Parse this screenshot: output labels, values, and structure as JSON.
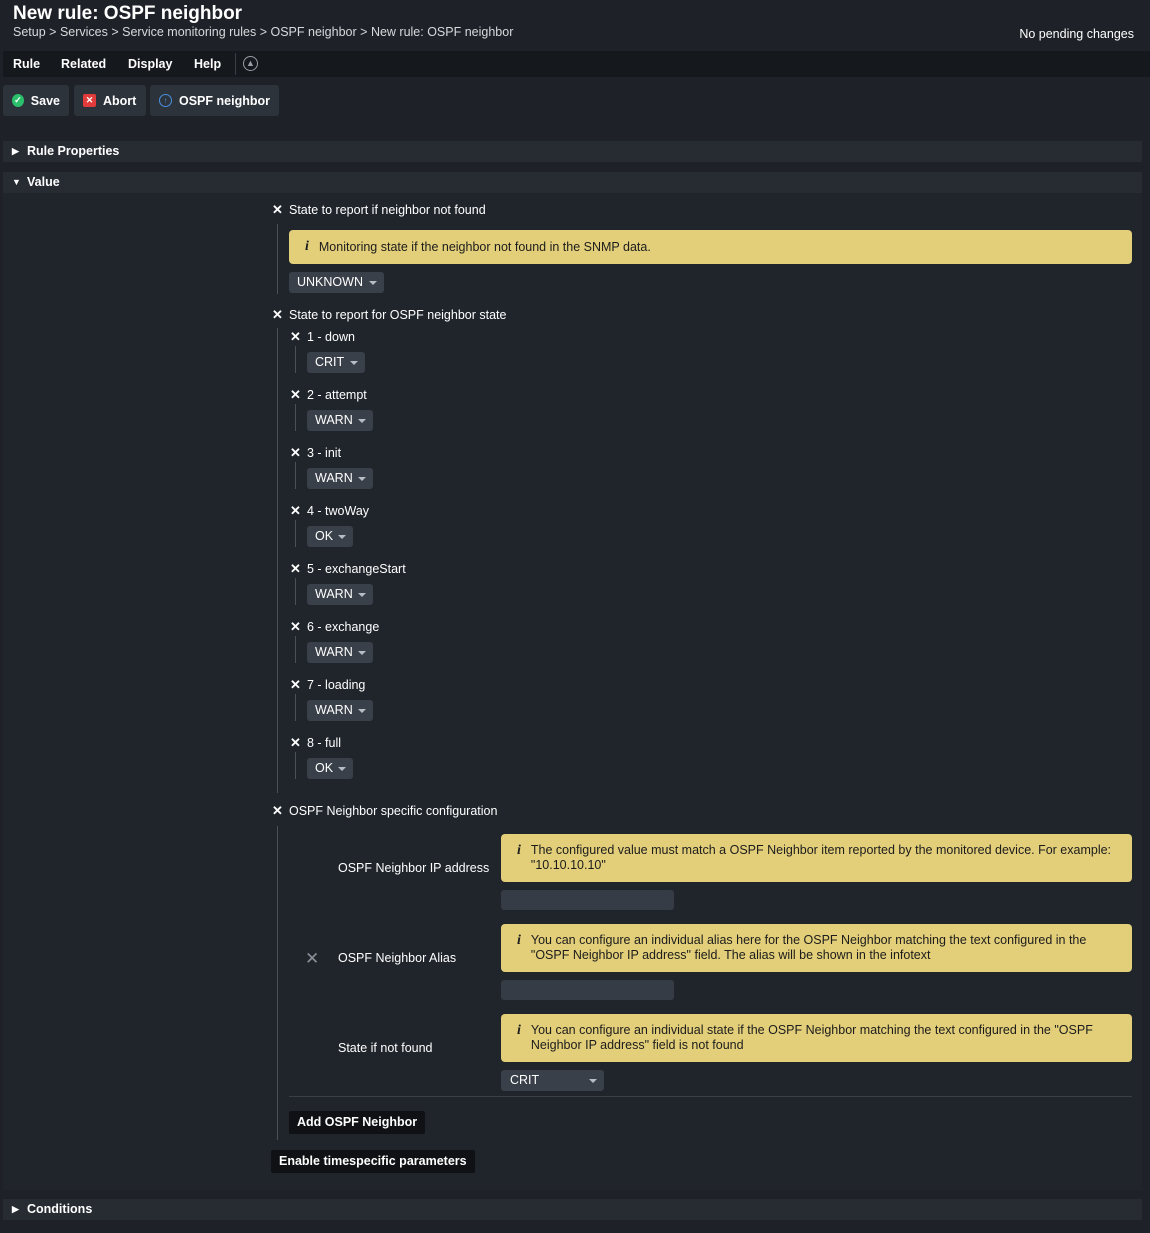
{
  "header": {
    "title": "New rule: OSPF neighbor",
    "breadcrumb": [
      "Setup",
      "Services",
      "Service monitoring rules",
      "OSPF neighbor",
      "New rule: OSPF neighbor"
    ],
    "pending": "No pending changes"
  },
  "menu": {
    "rule": "Rule",
    "related": "Related",
    "display": "Display",
    "help": "Help"
  },
  "toolbar": {
    "save": "Save",
    "abort": "Abort",
    "ospf": "OSPF neighbor"
  },
  "sections": {
    "rule_properties": "Rule Properties",
    "value": "Value",
    "conditions": "Conditions"
  },
  "not_found": {
    "label": "State to report if neighbor not found",
    "help": "Monitoring state if the neighbor not found in the SNMP data.",
    "value": "UNKNOWN"
  },
  "neighbor_state": {
    "label": "State to report for OSPF neighbor state",
    "items": [
      {
        "label": "1 - down",
        "value": "CRIT"
      },
      {
        "label": "2 - attempt",
        "value": "WARN"
      },
      {
        "label": "3 - init",
        "value": "WARN"
      },
      {
        "label": "4 - twoWay",
        "value": "OK"
      },
      {
        "label": "5 - exchangeStart",
        "value": "WARN"
      },
      {
        "label": "6 - exchange",
        "value": "WARN"
      },
      {
        "label": "7 - loading",
        "value": "WARN"
      },
      {
        "label": "8 - full",
        "value": "OK"
      }
    ]
  },
  "specific": {
    "label": "OSPF Neighbor specific configuration",
    "ip_label": "OSPF Neighbor IP address",
    "ip_help": "The configured value must match a OSPF Neighbor item reported by the monitored device. For example: \"10.10.10.10\"",
    "ip_value": "",
    "alias_label": "OSPF Neighbor Alias",
    "alias_help": "You can configure an individual alias here for the OSPF Neighbor matching the text configured in the \"OSPF Neighbor IP address\" field. The alias will be shown in the infotext",
    "alias_value": "",
    "state_label": "State if not found",
    "state_help": "You can configure an individual state if the OSPF Neighbor matching the text configured in the \"OSPF Neighbor IP address\" field is not found",
    "state_value": "CRIT",
    "add_button": "Add OSPF Neighbor"
  },
  "timespecific_button": "Enable timespecific parameters",
  "help_icon": "i",
  "colors": {
    "help_bg": "#e3cf7a",
    "save_icon": "#2bbf6b",
    "abort_icon": "#e23b3b",
    "ospf_icon": "#4a8fe0"
  }
}
